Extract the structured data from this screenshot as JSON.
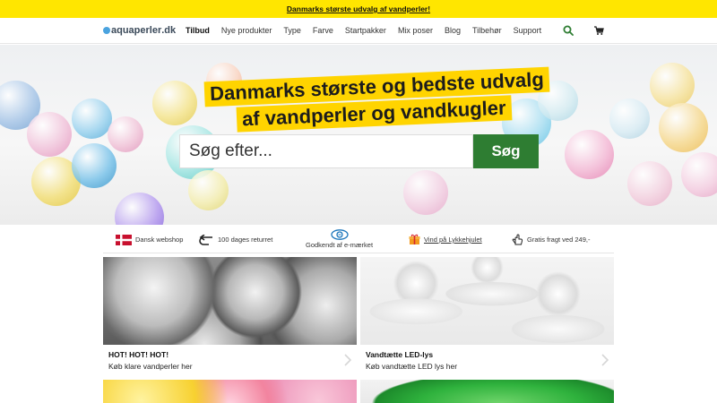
{
  "topbar": {
    "text": "Danmarks største udvalg af vandperler!"
  },
  "header": {
    "logo_main": "aquaperler",
    "logo_tld": ".dk",
    "nav": [
      "Tilbud",
      "Nye produkter",
      "Type",
      "Farve",
      "Startpakker",
      "Mix poser",
      "Blog",
      "Tilbehør",
      "Support"
    ],
    "icons": [
      "search-icon",
      "cart-icon"
    ]
  },
  "hero": {
    "headline_1": "Danmarks største og bedste udvalg",
    "headline_2": "af vandperler og vandkugler",
    "search_placeholder": "Søg efter...",
    "search_button": "Søg"
  },
  "usp": [
    {
      "icon": "danish-flag-icon",
      "label": "Dansk webshop"
    },
    {
      "icon": "return-arrow-icon",
      "label": "100 dages returret"
    },
    {
      "icon": "e-maerket-icon",
      "label": "Godkendt af e-mærket"
    },
    {
      "icon": "gift-icon",
      "label": "Vind på Lykkehjulet"
    },
    {
      "icon": "hand-icon",
      "label": "Gratis fragt ved 249,-"
    }
  ],
  "tiles": [
    {
      "title": "HOT! HOT! HOT!",
      "subtitle": "Køb klare vandperler her"
    },
    {
      "title": "Vandtætte LED-lys",
      "subtitle": "Køb vandtætte LED lys her"
    }
  ],
  "colors": {
    "topbar": "#ffe600",
    "headline_bg": "#ffd400",
    "search_button": "#2e7d32",
    "icon_green": "#2e7d32"
  }
}
